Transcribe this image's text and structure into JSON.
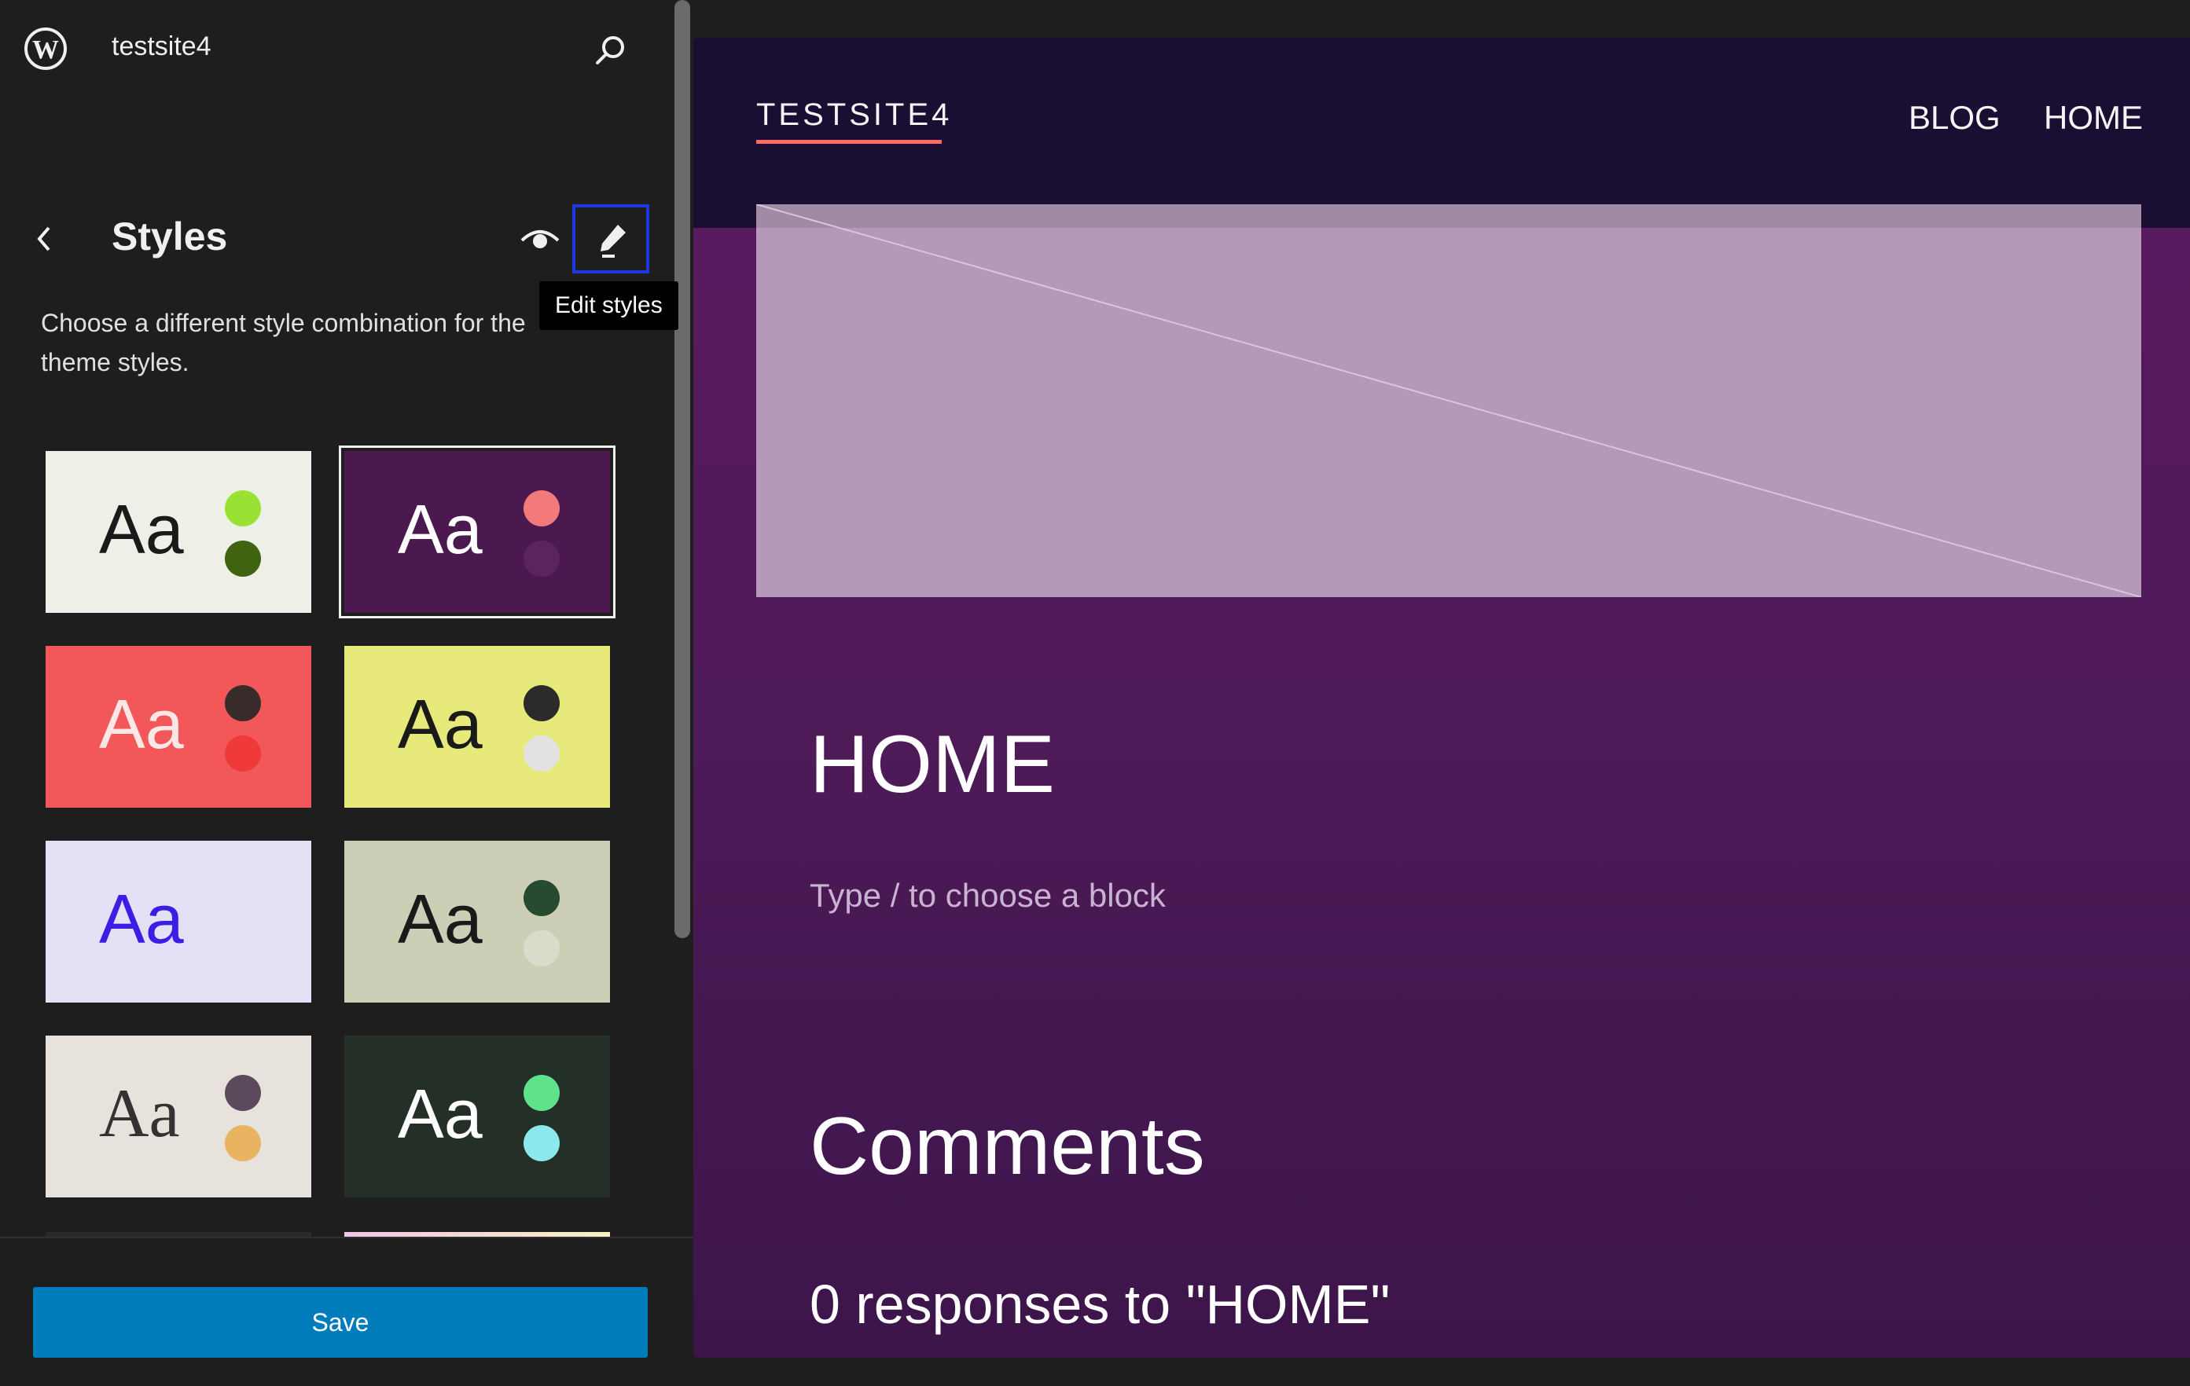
{
  "sidebar": {
    "site_name": "testsite4",
    "panel_title": "Styles",
    "description": "Choose a different style combination for the theme styles.",
    "tooltip": "Edit styles",
    "save_label": "Save",
    "variations": [
      {
        "sample": "Aa",
        "bg": "#eef0e8",
        "text": "#1a1a1a",
        "dot1": "#99e234",
        "dot2": "#3f6310"
      },
      {
        "sample": "Aa",
        "bg": "#4b1850",
        "text": "#ffffff",
        "dot1": "#f37a7a",
        "dot2": "#5c2361",
        "selected": true
      },
      {
        "sample": "Aa",
        "bg": "#f2585a",
        "text": "#fde6e6",
        "dot1": "#3a2b2b",
        "dot2": "#f03a3a"
      },
      {
        "sample": "Aa",
        "bg": "#e7e97a",
        "text": "#1a1a1a",
        "dot1": "#2b2b2b",
        "dot2": "#e2e2e2"
      },
      {
        "sample": "Aa",
        "bg": "#e4e0f5",
        "text": "#3b1ee6",
        "dot1": "#e4e0f5",
        "dot2": "#e4e0f5"
      },
      {
        "sample": "Aa",
        "bg": "#cdceb6",
        "text": "#1a1a1a",
        "dot1": "#274a30",
        "dot2": "#dadbcb"
      },
      {
        "sample": "Aa",
        "bg": "#e8e2dc",
        "text": "#333333",
        "dot1": "#5b4a5c",
        "dot2": "#e9b462"
      },
      {
        "sample": "Aa",
        "bg": "#243027",
        "text": "#ffffff",
        "dot1": "#5fe38a",
        "dot2": "#8be9ee"
      }
    ]
  },
  "preview": {
    "site_title": "TESTSITE4",
    "nav": [
      "BLOG",
      "HOME"
    ],
    "page_title": "HOME",
    "block_placeholder": "Type / to choose a block",
    "comments_title": "Comments",
    "responses": "0 responses to \"HOME\""
  }
}
